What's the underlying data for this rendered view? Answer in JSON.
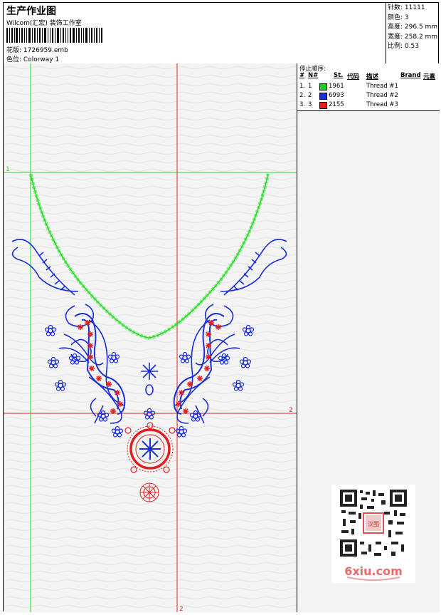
{
  "header": {
    "title": "生产作业图",
    "company": "Wilcom(汇宏) 装饰工作室",
    "design_label": "花版:",
    "design_value": "1726959.emb",
    "colorway_label": "色位:",
    "colorway_value": "Colorway 1"
  },
  "stats": [
    {
      "label": "针数:",
      "value": "11111"
    },
    {
      "label": "颜色:",
      "value": "3"
    },
    {
      "label": "高度:",
      "value": "296.5 mm"
    },
    {
      "label": "宽度:",
      "value": "258.2 mm"
    },
    {
      "label": "比例:",
      "value": "0.53"
    }
  ],
  "stop_sequence": {
    "title": "停止顺序:",
    "columns": [
      "#",
      "N#",
      "St.",
      "代码",
      "描述",
      "Brand",
      "元素"
    ],
    "rows": [
      {
        "num": "1.",
        "needle": "1",
        "color": "#22c922",
        "code": "1961",
        "desc": "Thread #1"
      },
      {
        "num": "2.",
        "needle": "2",
        "color": "#1a2fd8",
        "code": "6993",
        "desc": "Thread #2"
      },
      {
        "num": "3.",
        "needle": "3",
        "color": "#e02020",
        "code": "2155",
        "desc": "Thread #3"
      }
    ]
  },
  "guides": {
    "green_label": "1",
    "red_label_bottom": "2",
    "red_label_right": "2"
  },
  "colors": {
    "green": "#22dd22",
    "blue": "#1a2fd8",
    "red": "#e02020"
  },
  "watermark": {
    "text": "6xiu.com",
    "badge": "汉图"
  }
}
